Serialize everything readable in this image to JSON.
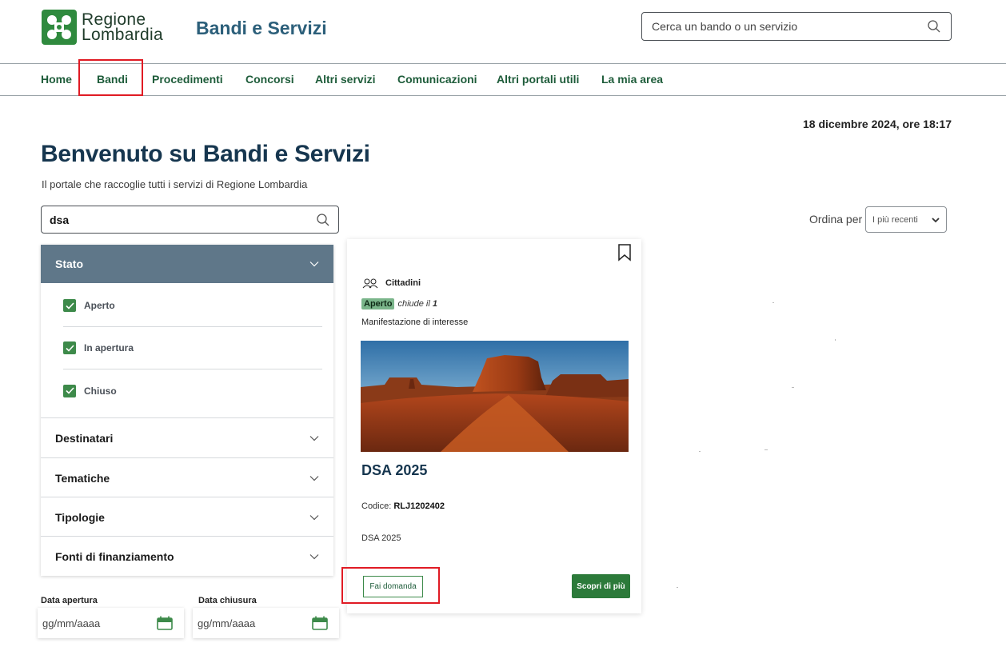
{
  "header": {
    "brand_line1": "Regione",
    "brand_line2": "Lombardia",
    "site_title": "Bandi e Servizi",
    "search_placeholder": "Cerca un bando o un servizio"
  },
  "nav": {
    "items": [
      "Home",
      "Bandi",
      "Procedimenti",
      "Concorsi",
      "Altri servizi",
      "Comunicazioni",
      "Altri portali utili",
      "La mia area"
    ]
  },
  "date_time": "18 dicembre 2024, ore 18:17",
  "welcome": {
    "title": "Benvenuto su Bandi e Servizi",
    "subtitle": "Il portale che raccoglie tutti i servizi di Regione Lombardia"
  },
  "search": {
    "value": "dsa"
  },
  "sort": {
    "label": "Ordina per",
    "selected": "I più recenti"
  },
  "filters": {
    "stato": {
      "label": "Stato",
      "options": [
        {
          "label": "Aperto",
          "checked": true
        },
        {
          "label": "In apertura",
          "checked": true
        },
        {
          "label": "Chiuso",
          "checked": true
        }
      ]
    },
    "sections": [
      "Destinatari",
      "Tematiche",
      "Tipologie",
      "Fonti di finanziamento"
    ]
  },
  "dates": {
    "open_label": "Data apertura",
    "close_label": "Data chiusura",
    "placeholder": "gg/mm/aaaa"
  },
  "card": {
    "audience": "Cittadini",
    "status_badge": "Aperto",
    "closes_text": "chiude il",
    "closes_value": "1",
    "type": "Manifestazione di interesse",
    "title": "DSA 2025",
    "code_label": "Codice:",
    "code_value": "RLJ1202402",
    "description": "DSA 2025",
    "apply_label": "Fai domanda",
    "more_label": "Scopri di più"
  },
  "colors": {
    "brand_green": "#2f8a3e",
    "nav_green": "#1e5c3a",
    "title_blue": "#16364f",
    "filter_header": "#5f7789",
    "highlight_red": "#e01b24"
  }
}
